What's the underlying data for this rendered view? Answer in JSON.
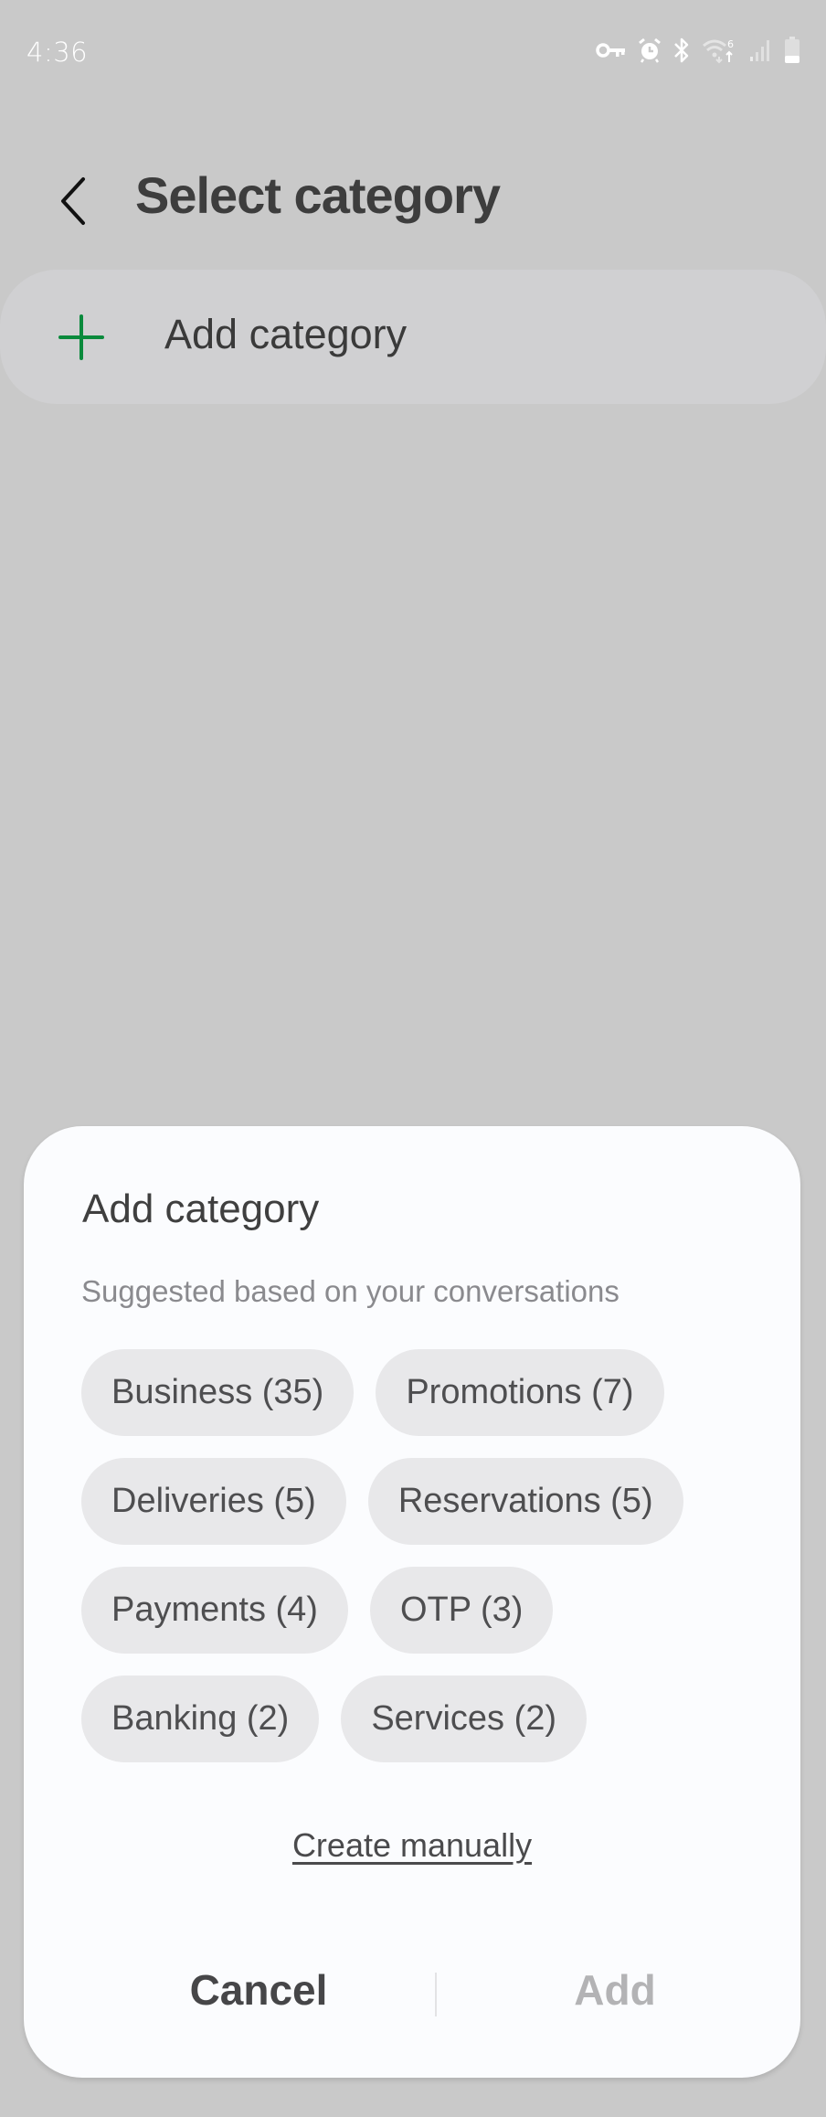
{
  "status_bar": {
    "time": "4:36",
    "icons": [
      "vpn-key-icon",
      "alarm-icon",
      "bluetooth-icon",
      "wifi-6-icon",
      "signal-icon",
      "battery-icon"
    ]
  },
  "header": {
    "back_icon": "chevron-left-icon",
    "title": "Select category"
  },
  "add_row": {
    "icon": "plus-icon",
    "label": "Add category",
    "icon_color": "#0a8a3c"
  },
  "sheet": {
    "title": "Add category",
    "subtitle": "Suggested based on your conversations",
    "chips": [
      {
        "label": "Business (35)"
      },
      {
        "label": "Promotions (7)"
      },
      {
        "label": "Deliveries (5)"
      },
      {
        "label": "Reservations (5)"
      },
      {
        "label": "Payments (4)"
      },
      {
        "label": "OTP (3)"
      },
      {
        "label": "Banking (2)"
      },
      {
        "label": "Services (2)"
      }
    ],
    "create_manually": "Create manually",
    "cancel_label": "Cancel",
    "add_label": "Add"
  }
}
